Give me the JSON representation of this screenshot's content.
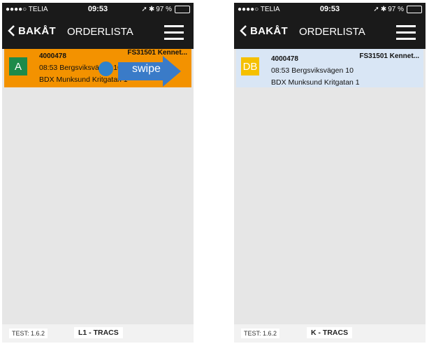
{
  "left": {
    "status": {
      "carrier": "●●●●○ TELIA",
      "time": "09:53",
      "battery": "97 %"
    },
    "nav": {
      "back": "BAKÅT",
      "title": "ORDERLISTA"
    },
    "order": {
      "badge": "A",
      "number": "4000478",
      "fs": "FS31501 Kennet...",
      "line1": "08:53 Bergsviksvägen 10",
      "line2": "BDX Munksund Kritgatan 1",
      "badge_color": "#1e8a4a",
      "bg_color": "#f39200"
    },
    "swipe_label": "swipe",
    "footer": {
      "test": "TEST: 1.6.2",
      "tracs": "L1 - TRACS"
    }
  },
  "right": {
    "status": {
      "carrier": "●●●●○ TELIA",
      "time": "09:53",
      "battery": "97 %"
    },
    "nav": {
      "back": "BAKÅT",
      "title": "ORDERLISTA"
    },
    "order": {
      "badge": "DB",
      "number": "4000478",
      "fs": "FS31501 Kennet...",
      "line1": "08:53 Bergsviksvägen 10",
      "line2": "BDX Munksund Kritgatan 1",
      "badge_color": "#f5c000",
      "bg_color": "#d9e6f5"
    },
    "footer": {
      "test": "TEST: 1.6.2",
      "tracs": "K - TRACS"
    }
  }
}
